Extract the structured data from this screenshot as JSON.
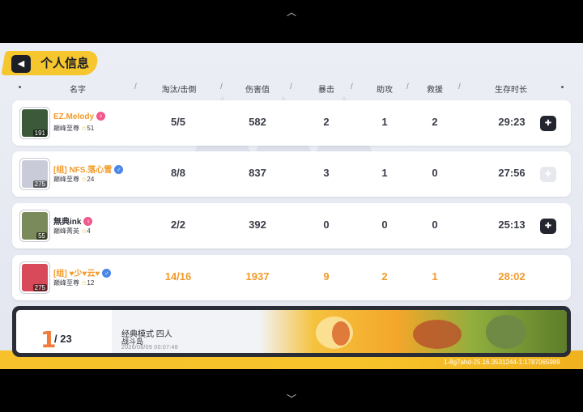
{
  "header": {
    "title": "个人信息",
    "back_glyph": "◀"
  },
  "columns": [
    "名字",
    "淘汰/击倒",
    "伤害值",
    "暴击",
    "助攻",
    "救援",
    "生存时长"
  ],
  "players": [
    {
      "name": "EZ.Melody",
      "gender": "female",
      "rank": "巅峰至尊",
      "stars": "51",
      "level": "191",
      "elims": "5/5",
      "damage": "582",
      "crit": "2",
      "assist": "1",
      "rescue": "2",
      "survival": "29:23",
      "me": false,
      "action_enabled": true,
      "avatar_color": "#3c5a3a"
    },
    {
      "name": "[组] NFS.落心雪",
      "gender": "male",
      "rank": "巅峰至尊",
      "stars": "24",
      "level": "275",
      "elims": "8/8",
      "damage": "837",
      "crit": "3",
      "assist": "1",
      "rescue": "0",
      "survival": "27:56",
      "me": false,
      "action_enabled": false,
      "avatar_color": "#c9ccd8"
    },
    {
      "name": "無典ink",
      "gender": "female",
      "rank": "巅峰菁英",
      "stars": "4",
      "level": "55",
      "elims": "2/2",
      "damage": "392",
      "crit": "0",
      "assist": "0",
      "rescue": "0",
      "survival": "25:13",
      "me": false,
      "action_enabled": true,
      "avatar_color": "#7a8a5a"
    },
    {
      "name": "[组] ♥少♥云♥",
      "gender": "male",
      "rank": "巅峰至尊",
      "stars": "12",
      "level": "275",
      "elims": "14/16",
      "damage": "1937",
      "crit": "9",
      "assist": "2",
      "rescue": "1",
      "survival": "28:02",
      "me": true,
      "action_enabled": false,
      "avatar_color": "#d84a5a"
    }
  ],
  "footer": {
    "place": "1",
    "total": "/ 23",
    "mode": "经典模式 四人",
    "map": "战斗岛",
    "time": "2026/08/09 00:07:48"
  },
  "session_id": "1-8g7ahd-25.16.3531244-1:1787065989",
  "colors": {
    "accent": "#f6c62e",
    "highlight": "#f29a2a",
    "dark": "#23262f"
  }
}
